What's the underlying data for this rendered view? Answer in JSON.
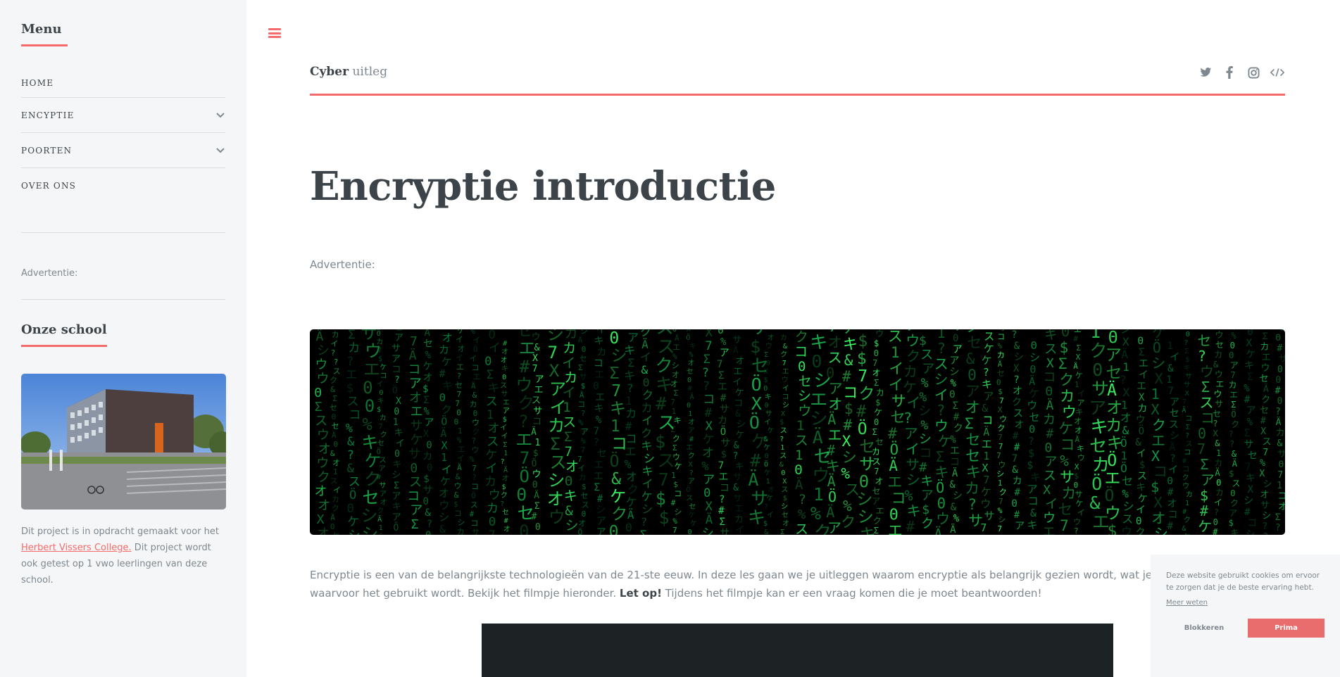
{
  "sidebar": {
    "menu_heading": "Menu",
    "menu_items": [
      {
        "label": "Home",
        "has_submenu": false
      },
      {
        "label": "Encyptie",
        "has_submenu": true
      },
      {
        "label": "Poorten",
        "has_submenu": true
      },
      {
        "label": "Over ons",
        "has_submenu": false
      }
    ],
    "ad_label": "Advertentie:",
    "school_heading": "Onze school",
    "school_text_before": "Dit project is in opdracht gemaakt voor het ",
    "school_link": "Herbert Vissers College.",
    "school_text_after": " Dit project wordt ook getest op 1 vwo leerlingen van deze school."
  },
  "header": {
    "logo_bold": "Cyber",
    "logo_rest": " uitleg",
    "social_icons": [
      "twitter-icon",
      "facebook-icon",
      "instagram-icon",
      "code-icon"
    ]
  },
  "main": {
    "title": "Encryptie introductie",
    "ad_label": "Advertentie:",
    "intro_before": "Encryptie is een van de belangrijkste technologieën van de 21-ste eeuw. In deze les gaan we je uitleggen waarom encryptie als belangrijk gezien wordt, wat je er mee gedaan wordt en waarvoor het gebruikt wordt. Bekijk het filmpje hieronder. ",
    "intro_bold": "Let op!",
    "intro_after": " Tijdens het filmpje kan er een vraag komen die je moet beantwoorden!"
  },
  "cookie": {
    "message": "Deze website gebruikt cookies om ervoor te zorgen dat je de beste ervaring hebt.",
    "link": "Meer weten",
    "block_label": "Blokkeren",
    "accept_label": "Prima"
  },
  "colors": {
    "accent": "#f56a6a",
    "sidebar_bg": "#f5f6f7",
    "heading": "#3d4449",
    "text": "#7f888f"
  }
}
